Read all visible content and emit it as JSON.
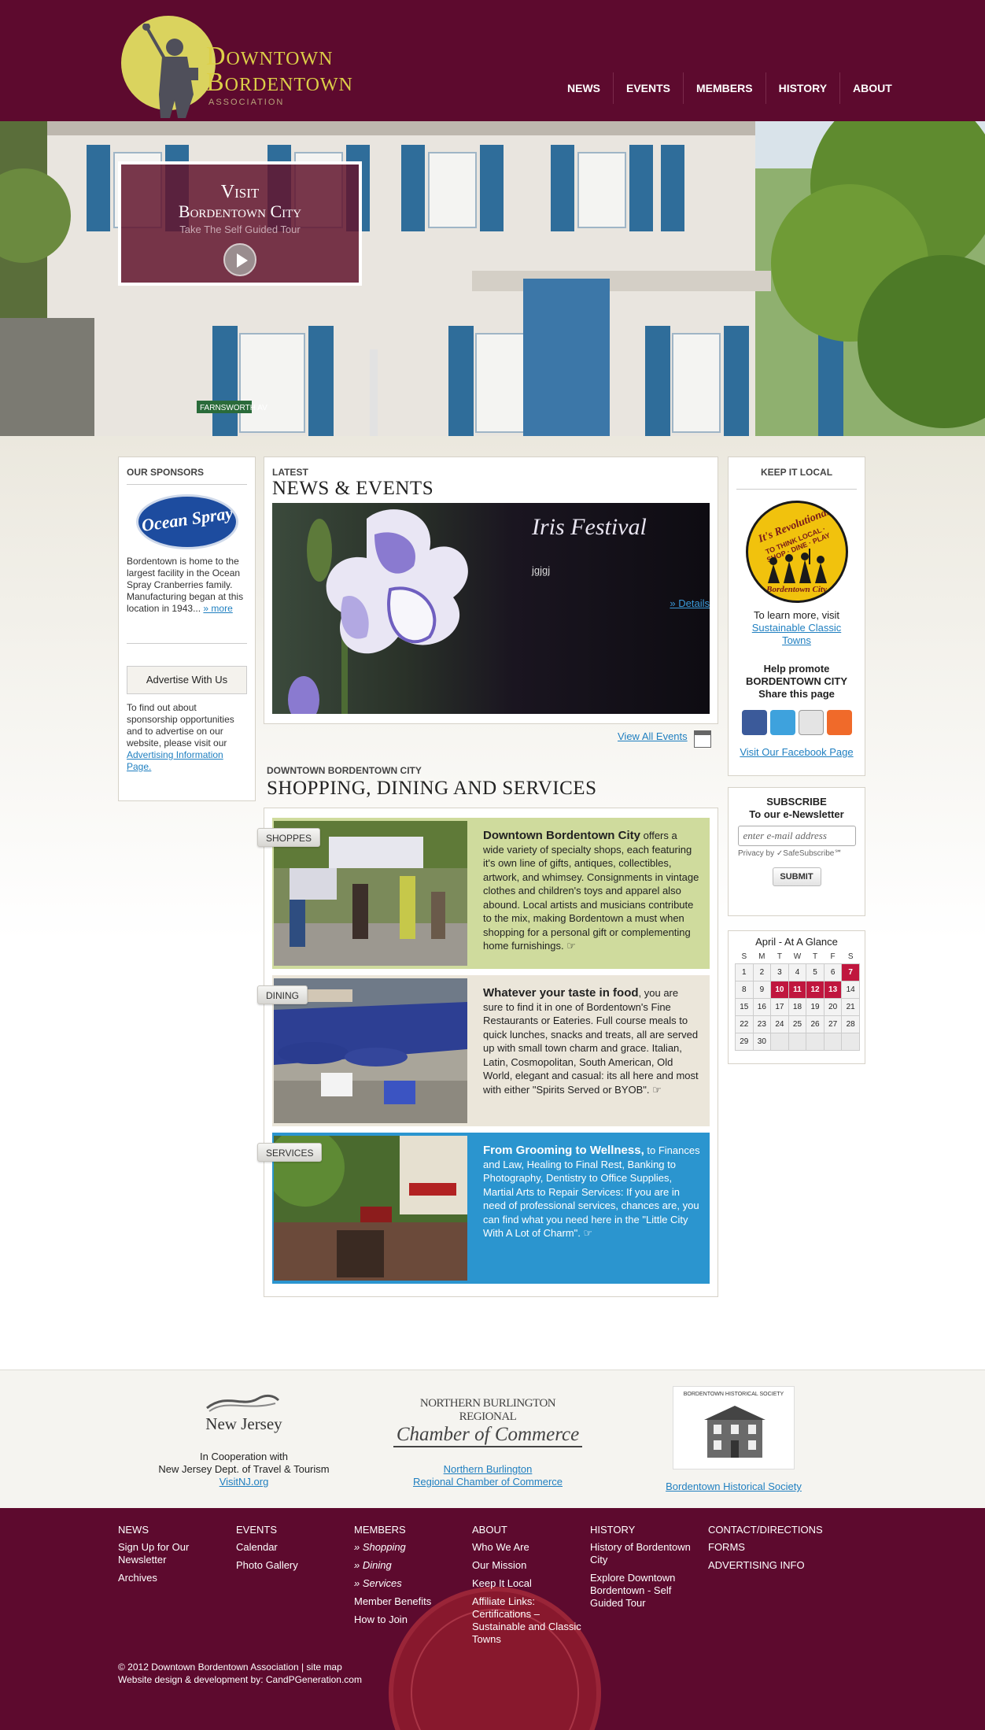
{
  "header": {
    "logo_line1": "Downtown",
    "logo_line2": "Bordentown",
    "logo_line3": "ASSOCIATION",
    "nav": [
      "NEWS",
      "EVENTS",
      "MEMBERS",
      "HISTORY",
      "ABOUT"
    ]
  },
  "hero": {
    "visit_line1": "Visit",
    "visit_line2": "Bordentown City",
    "visit_sub": "Take The Self Guided Tour",
    "street_sign": "FARNSWORTH AV"
  },
  "sponsors": {
    "heading": "OUR SPONSORS",
    "logo_text": "Ocean Spray",
    "text": "Bordentown is home to the largest facility in the Ocean Spray Cranberries family. Manufacturing began at this location in 1943...",
    "more_link": "» more",
    "advertise_button": "Advertise With Us",
    "advertise_text": "To find out about sponsorship opportunities and to advertise on our website, please visit our",
    "advertise_link": "Advertising Information Page."
  },
  "news": {
    "label": "LATEST",
    "title": "NEWS & EVENTS",
    "slide_title": "Iris Festival",
    "slide_sub": "jgjgj",
    "slide_details": "» Details",
    "view_all": "View All Events"
  },
  "shopping": {
    "label": "DOWNTOWN BORDENTOWN CITY",
    "title": "SHOPPING, DINING AND SERVICES",
    "rows": [
      {
        "tab": "SHOPPES",
        "lead": "Downtown Bordentown City",
        "text": " offers a wide variety of specialty shops, each featuring it's own line of gifts, antiques, collectibles, artwork, and whimsey. Consignments in vintage clothes and children's toys and apparel also abound. Local artists and musicians contribute to the mix, making Bordentown a must when shopping for a personal gift or complementing home furnishings. ☞",
        "bg": "#cfdb9d"
      },
      {
        "tab": "DINING",
        "lead": "Whatever your taste in food",
        "text": ", you are sure to find it in one of Bordentown's Fine Restaurants or Eateries.  Full course meals to quick lunches, snacks and treats, all are served up with small town charm and grace.  Italian, Latin, Cosmopolitan, South American, Old World, elegant and casual: its all here and most with either \"Spirits Served or BYOB\". ☞",
        "bg": "#ebe6da"
      },
      {
        "tab": "SERVICES",
        "lead": "From Grooming to Wellness,",
        "text": " to Finances and Law, Healing to Final Rest, Banking to Photography, Dentistry to Office Supplies, Martial Arts to Repair Services: If you are in need of professional services, chances are, you can find what you need here in the \"Little City With A Lot of Charm\". ☞",
        "bg": "#2b95cf"
      }
    ]
  },
  "keep_local": {
    "heading": "KEEP IT LOCAL",
    "badge_text": "It's Revolutionary",
    "badge_sub": "TO THINK LOCAL · SHOP · DINE · PLAY",
    "badge_bottom": "Bordentown City",
    "text": "To learn more, visit",
    "link": "Sustainable Classic Towns",
    "promote_line1": "Help promote",
    "promote_line2": "BORDENTOWN CITY",
    "promote_line3": "Share this page",
    "facebook_link": "Visit Our Facebook Page"
  },
  "subscribe": {
    "title_line1": "SUBSCRIBE",
    "title_line2": "To our e-Newsletter",
    "placeholder": "enter e-mail address",
    "privacy": "Privacy by ✓SafeSubscribe℠",
    "submit": "SUBMIT"
  },
  "calendar": {
    "title": "April - At A Glance",
    "days": [
      "S",
      "M",
      "T",
      "W",
      "T",
      "F",
      "S"
    ],
    "weeks": [
      [
        "1",
        "2",
        "3",
        "4",
        "5",
        "6",
        "7"
      ],
      [
        "8",
        "9",
        "10",
        "11",
        "12",
        "13",
        "14"
      ],
      [
        "15",
        "16",
        "17",
        "18",
        "19",
        "20",
        "21"
      ],
      [
        "22",
        "23",
        "24",
        "25",
        "26",
        "27",
        "28"
      ],
      [
        "29",
        "30",
        "",
        "",
        "",
        "",
        ""
      ]
    ],
    "highlighted": [
      "7",
      "10",
      "11",
      "12",
      "13"
    ]
  },
  "partners": {
    "nj_logo": "New Jersey",
    "nj_line1": "In Cooperation with",
    "nj_line2": "New Jersey Dept. of Travel & Tourism",
    "nj_link": "VisitNJ.org",
    "chamber_logo1": "NORTHERN BURLINGTON REGIONAL",
    "chamber_logo2": "Chamber of Commerce",
    "chamber_link1": "Northern Burlington",
    "chamber_link2": "Regional Chamber of Commerce",
    "hist_logo": "BORDENTOWN HISTORICAL SOCIETY",
    "hist_link": "Bordentown Historical Society"
  },
  "footer": {
    "columns": [
      {
        "heading": "NEWS",
        "items": [
          "Sign Up for Our Newsletter",
          "Archives"
        ]
      },
      {
        "heading": "EVENTS",
        "items": [
          "Calendar",
          "Photo Gallery"
        ]
      },
      {
        "heading": "MEMBERS",
        "items": [
          "» Shopping",
          "» Dining",
          "» Services",
          "Member Benefits",
          "How to Join"
        ]
      },
      {
        "heading": "ABOUT",
        "items": [
          "Who We Are",
          "Our Mission",
          "Keep It Local",
          "Affiliate Links: Certifications – Sustainable and Classic Towns"
        ]
      },
      {
        "heading": "HISTORY",
        "items": [
          "History of Bordentown City",
          "Explore Downtown Bordentown - Self Guided Tour"
        ]
      },
      {
        "heading": "CONTACT/DIRECTIONS",
        "items": [
          "FORMS",
          "ADVERTISING INFO"
        ]
      }
    ],
    "copyright": "© 2012 Downtown Bordentown Association | site map",
    "credits": "Website design & development by: CandPGeneration.com"
  },
  "colors": {
    "maroon": "#5d0a2e",
    "gold": "#dccf48",
    "link": "#1f7fc0",
    "calendar_highlight": "#c0163e"
  }
}
